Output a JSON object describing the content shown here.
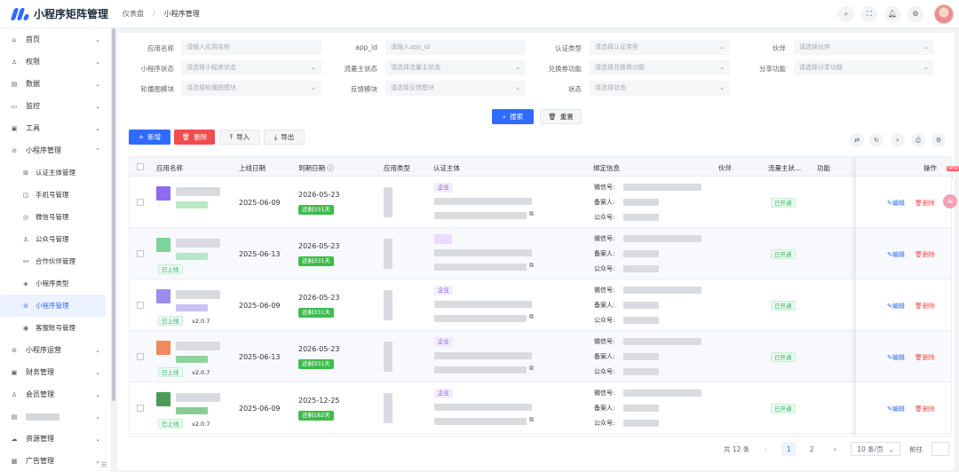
{
  "app": {
    "title": "小程序矩阵管理"
  },
  "breadcrumb": [
    "仪表盘",
    "小程序管理"
  ],
  "header_icons": [
    "search-icon",
    "fullscreen-icon",
    "bell-icon",
    "settings-icon"
  ],
  "sidebar": {
    "items": [
      {
        "label": "首页",
        "icon": "home-icon",
        "arrow": "⌄"
      },
      {
        "label": "权限",
        "icon": "user-key-icon",
        "arrow": "⌄"
      },
      {
        "label": "数据",
        "icon": "data-icon",
        "arrow": "⌄"
      },
      {
        "label": "监控",
        "icon": "monitor-icon",
        "arrow": "⌄"
      },
      {
        "label": "工具",
        "icon": "tool-icon",
        "arrow": "⌄"
      },
      {
        "label": "小程序管理",
        "icon": "miniprogram-icon",
        "arrow": "⌃"
      }
    ],
    "sub_items": [
      {
        "label": "认证主体管理",
        "icon": "cert-icon"
      },
      {
        "label": "手机号管理",
        "icon": "phone-icon"
      },
      {
        "label": "微信号管理",
        "icon": "wechat-icon"
      },
      {
        "label": "公众号管理",
        "icon": "official-icon"
      },
      {
        "label": "合作伙伴管理",
        "icon": "partner-icon"
      },
      {
        "label": "小程序类型",
        "icon": "type-icon"
      },
      {
        "label": "小程序管理",
        "icon": "miniprogram-icon",
        "active": true
      },
      {
        "label": "客服账号管理",
        "icon": "service-icon"
      }
    ],
    "bottom_items": [
      {
        "label": "小程序运营",
        "icon": "ops-icon",
        "arrow": "⌄"
      },
      {
        "label": "财务管理",
        "icon": "finance-icon",
        "arrow": "⌄"
      },
      {
        "label": "会员管理",
        "icon": "member-icon",
        "arrow": "⌄"
      },
      {
        "label": "",
        "icon": "file-icon",
        "arrow": "⌄"
      },
      {
        "label": "资源管理",
        "icon": "cloud-icon",
        "arrow": "⌄"
      },
      {
        "label": "广告管理",
        "icon": "ad-icon",
        "arrow": "⌄"
      }
    ],
    "collapse_glyph": "☰"
  },
  "filters": {
    "app_name": {
      "label": "应用名称",
      "placeholder": "请输入应用名称"
    },
    "app_id": {
      "label": "app_id",
      "placeholder": "请输入app_id"
    },
    "cert_type": {
      "label": "认证类型",
      "placeholder": "请选择认证类型"
    },
    "partner": {
      "label": "伙伴",
      "placeholder": "请选择伙伴"
    },
    "mp_status": {
      "label": "小程序状态",
      "placeholder": "请选择小程序状态"
    },
    "traffic_status": {
      "label": "流量主状态",
      "placeholder": "请选择流量主状态"
    },
    "coupon": {
      "label": "兑换券功能",
      "placeholder": "请选择兑换券功能"
    },
    "share": {
      "label": "分享功能",
      "placeholder": "请选择分享功能"
    },
    "carousel": {
      "label": "轮播图模块",
      "placeholder": "请选择轮播图模块"
    },
    "feedback": {
      "label": "反馈模块",
      "placeholder": "请选择反馈模块"
    },
    "status": {
      "label": "状态",
      "placeholder": "请选择状态"
    }
  },
  "actions": {
    "search": "搜索",
    "reset": "重置",
    "add": "新增",
    "delete": "删除",
    "import": "导入",
    "export": "导出"
  },
  "table": {
    "headers": [
      "应用名称",
      "上线日期",
      "到期日期",
      "应用类型",
      "认证主体",
      "绑定信息",
      "伙伴",
      "流量主状...",
      "功能",
      "操作"
    ],
    "bind_labels": [
      "微信号:",
      "备案人:",
      "公众号:"
    ],
    "rows": [
      {
        "online": "2025-06-09",
        "expire": "2026-05-23",
        "remain": "还剩331天",
        "cert": "企业",
        "status_tag": "",
        "version": "",
        "traffic": "已开通",
        "icon_color": "#8b6cf0",
        "icon_color2": "#b9e8c3"
      },
      {
        "online": "2025-06-13",
        "expire": "2026-05-23",
        "remain": "还剩331天",
        "cert": "",
        "status_tag": "已上线",
        "version": "",
        "traffic": "已开通",
        "icon_color": "#7bd49a",
        "icon_color2": "#b6e5c9"
      },
      {
        "online": "2025-06-09",
        "expire": "2026-05-23",
        "remain": "还剩331天",
        "cert": "企业",
        "status_tag": "已上线",
        "version": "v2.0.7",
        "traffic": "已开通",
        "icon_color": "#9b8df0",
        "icon_color2": "#c9c2f5"
      },
      {
        "online": "2025-06-13",
        "expire": "2026-05-23",
        "remain": "还剩331天",
        "cert": "企业",
        "status_tag": "已上线",
        "version": "v2.0.7",
        "traffic": "已开通",
        "icon_color": "#f08a5c",
        "icon_color2": "#8cd59d"
      },
      {
        "online": "2025-06-09",
        "expire": "2025-12-25",
        "remain": "还剩182天",
        "cert": "企业",
        "status_tag": "已上线",
        "version": "v2.0.7",
        "traffic": "已开通",
        "icon_color": "#4f9a5a",
        "icon_color2": "#8acb93"
      }
    ],
    "edit_label": "编辑",
    "delete_label": "删除"
  },
  "pagination": {
    "total": "共 12 条",
    "pages": [
      "1",
      "2"
    ],
    "active": "1",
    "size": "10 条/页",
    "goto": "前往",
    "prev": "‹",
    "next": "›"
  },
  "float": {
    "badge": "NEW",
    "ai": "AI"
  },
  "colors": {
    "primary": "#2f6bff",
    "danger": "#f24c4c",
    "success": "#3dbb4c"
  }
}
